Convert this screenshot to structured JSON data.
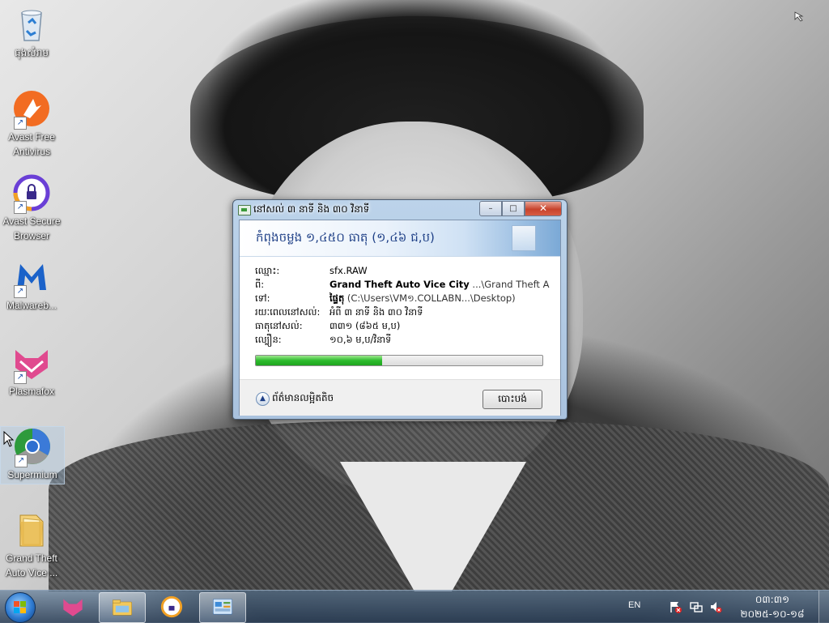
{
  "desktop": {
    "icons": [
      {
        "label": "ធុងសំរាម",
        "icon": "recycle-bin-icon"
      },
      {
        "label": "Avast Free Antivirus",
        "icon": "avast-antivirus-icon"
      },
      {
        "label": "Avast Secure Browser",
        "icon": "avast-browser-icon"
      },
      {
        "label": "Malwareb...",
        "icon": "malwarebytes-icon"
      },
      {
        "label": "Plasmafox",
        "icon": "plasmafox-icon"
      },
      {
        "label": "Supermium",
        "icon": "supermium-icon"
      },
      {
        "label": "Grand Theft Auto Vice ...",
        "icon": "folder-icon"
      }
    ]
  },
  "dialog": {
    "title": "នៅសល់ ៣ នាទី និង ៣០ វិនាទី",
    "header": "កំពុងចម្លង ១,៤៥០ ធាតុ (១,៤៦ ជ,ប)",
    "rows": [
      {
        "label": "ឈ្មោះ:",
        "value": "sfx.RAW"
      },
      {
        "label": "ពី:",
        "value_bold": "Grand Theft Auto Vice City",
        "value": " ...\\Grand Theft Auto V"
      },
      {
        "label": "ទៅ:",
        "value_bold": "ផ្ទៃតុ",
        "value": " (C:\\Users\\VM១.COLLABN...\\Desktop)"
      },
      {
        "label": "រយៈពេលនៅសល់:",
        "value": "អំពី ៣ នាទី និង ៣០ វិនាទី"
      },
      {
        "label": "ធាតុនៅសល់:",
        "value": "៣៣១ (៨៦៥ ម,ប)"
      },
      {
        "label": "ល្បឿន:",
        "value": "១០,៦ ម,ប/វិនាទី"
      }
    ],
    "progress": 0.44,
    "more_info_label": "ព័ត៌មានលម្អិតតិច",
    "cancel_label": "បោះបង់",
    "caption": {
      "minimize": "–",
      "maximize": "□",
      "close": "✕"
    }
  },
  "taskbar": {
    "language": "EN",
    "time": "០៣:៣១",
    "date": "២០២៥-១០-១៨",
    "items": [
      "plasmafox-icon",
      "file-explorer-icon",
      "avast-browser-icon",
      "control-panel-icon"
    ],
    "tray": [
      "flag-icon",
      "network-icon",
      "volume-muted-icon"
    ]
  }
}
